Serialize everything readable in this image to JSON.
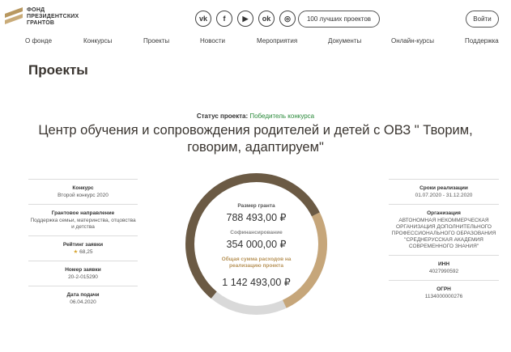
{
  "header": {
    "logo_lines": [
      "ФОНД",
      "ПРЕЗИДЕНТСКИХ",
      "ГРАНТОВ"
    ],
    "social": [
      {
        "icon": "vk-icon",
        "glyph": "vk"
      },
      {
        "icon": "facebook-icon",
        "glyph": "f"
      },
      {
        "icon": "youtube-icon",
        "glyph": "▶"
      },
      {
        "icon": "odnoklassniki-icon",
        "glyph": "ok"
      },
      {
        "icon": "instagram-icon",
        "glyph": "◎"
      }
    ],
    "best_projects_label": "100 лучших проектов",
    "login_label": "Войти"
  },
  "nav": {
    "items": [
      "О фонде",
      "Конкурсы",
      "Проекты",
      "Новости",
      "Мероприятия",
      "Документы",
      "Онлайн-курсы",
      "Поддержка"
    ]
  },
  "page": {
    "title": "Проекты",
    "status_label": "Статус проекта:",
    "status_value": "Победитель конкурса",
    "project_name": "Центр обучения и сопровождения родителей и детей с ОВЗ \" Творим, говорим, адаптируем\""
  },
  "left": {
    "contest_label": "Конкурс",
    "contest_value": "Второй конкурс 2020",
    "direction_label": "Грантовое направление",
    "direction_value": "Поддержка семьи, материнства, отцовства и детства",
    "rating_label": "Рейтинг заявки",
    "rating_value": "68,25",
    "number_label": "Номер заявки",
    "number_value": "20-2-015290",
    "date_label": "Дата подачи",
    "date_value": "06.04.2020"
  },
  "right": {
    "period_label": "Сроки реализации",
    "period_value": "01.07.2020 - 31.12.2020",
    "org_label": "Организация",
    "org_value": "АВТОНОМНАЯ НЕКОММЕРЧЕСКАЯ ОРГАНИЗАЦИЯ ДОПОЛНИТЕЛЬНОГО ПРОФЕССИОНАЛЬНОГО ОБРАЗОВАНИЯ \"СРЕДНЕРУССКАЯ АКАДЕМИЯ СОВРЕМЕННОГО ЗНАНИЯ\"",
    "inn_label": "ИНН",
    "inn_value": "4027990592",
    "ogrn_label": "ОГРН",
    "ogrn_value": "1134000000276"
  },
  "finance": {
    "grant_label": "Размер гранта",
    "grant_value": "788 493,00 ₽",
    "cofin_label": "Софинансирование",
    "cofin_value": "354 000,00 ₽",
    "total_label": "Общая сумма расходов на реализацию проекта",
    "total_value": "1 142 493,00 ₽",
    "grant_amount": 788493,
    "cofin_amount": 354000,
    "colors": {
      "grant": "#6b5a44",
      "cofin": "#c6a67a",
      "track": "#d9d9d9"
    }
  }
}
